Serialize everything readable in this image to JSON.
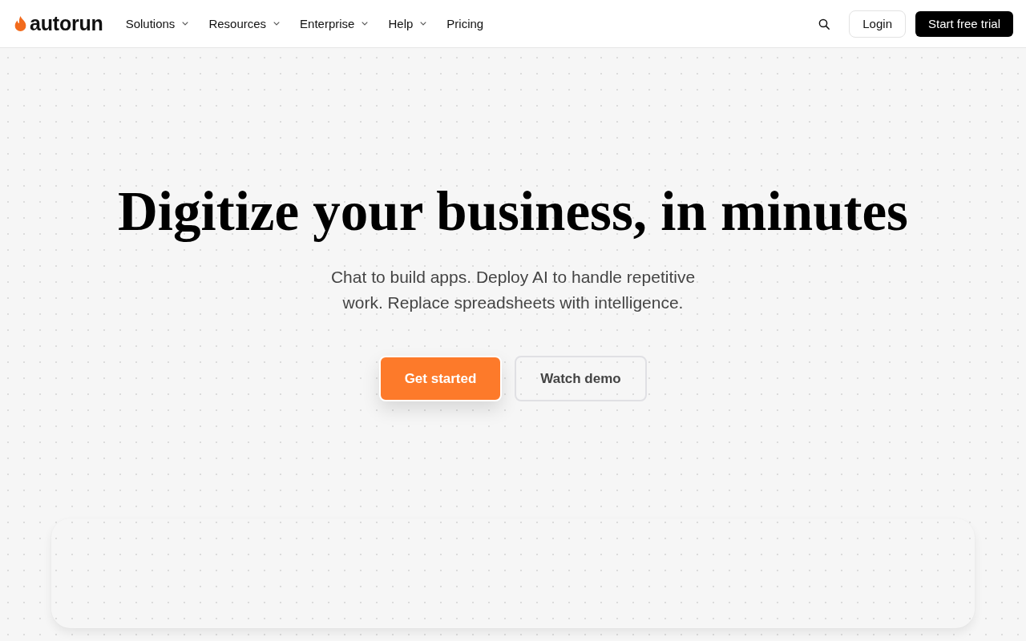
{
  "header": {
    "logo": {
      "text": "autorun"
    },
    "nav": [
      {
        "label": "Solutions",
        "has_menu": true
      },
      {
        "label": "Resources",
        "has_menu": true
      },
      {
        "label": "Enterprise",
        "has_menu": true
      },
      {
        "label": "Help",
        "has_menu": true
      },
      {
        "label": "Pricing",
        "has_menu": false
      }
    ],
    "buttons": [
      {
        "label": "Login",
        "kind": "outline"
      },
      {
        "label": "Start free trial",
        "kind": "dark"
      }
    ]
  },
  "hero": {
    "title": "Digitize your business, in minutes",
    "subtitle": "Chat to build apps. Deploy AI to handle repetitive work. Replace spreadsheets with intelligence.",
    "buttons": [
      {
        "label": "Get started",
        "kind": "primary"
      },
      {
        "label": "Watch demo",
        "kind": "secondary"
      }
    ]
  }
}
